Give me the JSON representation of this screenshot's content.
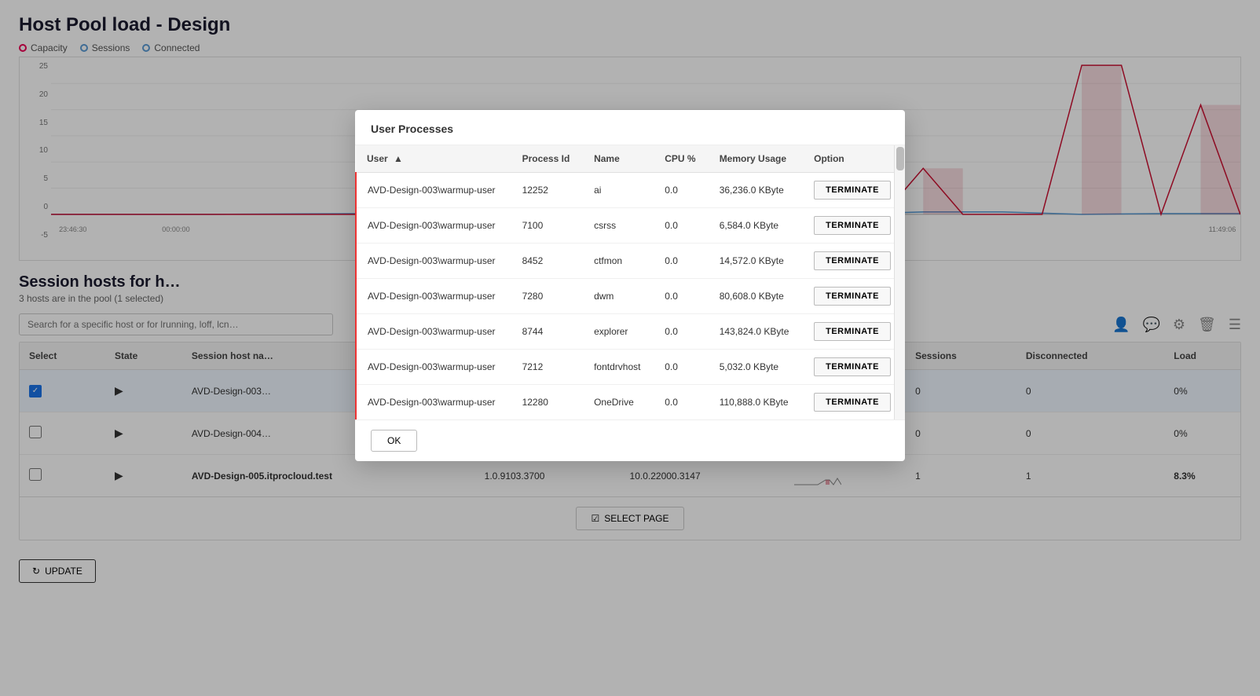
{
  "page": {
    "title": "Host Pool load - Design"
  },
  "legend": {
    "capacity_label": "Capacity",
    "sessions_label": "Sessions",
    "connected_label": "Connected"
  },
  "chart": {
    "y_axis": [
      "25",
      "20",
      "15",
      "10",
      "5",
      "0",
      "-5"
    ],
    "x_labels": [
      "23:46:30",
      "00:00:00",
      "11:49:06"
    ]
  },
  "session_hosts": {
    "title": "Session hosts for h…",
    "subtitle": "3 hosts are in the pool (1 selected)",
    "search_placeholder": "Search for a specific host or for lrunning, loff, lcn…",
    "columns": [
      "Select",
      "State",
      "Session host na…",
      "",
      "",
      "",
      "Sessions",
      "Disconnected",
      "Load"
    ],
    "rows": [
      {
        "select": true,
        "state": "running",
        "name": "AVD-Design-003…",
        "col4": "",
        "col5": "",
        "col6": "",
        "sessions": "0",
        "disconnected": "0",
        "load": "0%",
        "bold": false,
        "selected": true
      },
      {
        "select": false,
        "state": "running",
        "name": "AVD-Design-004…",
        "col4": "",
        "col5": "",
        "col6": "",
        "sessions": "0",
        "disconnected": "0",
        "load": "0%",
        "bold": false,
        "selected": false
      },
      {
        "select": false,
        "state": "running",
        "name": "AVD-Design-005.itprocloud.test",
        "col4": "1.0.9103.3700",
        "col5": "10.0.22000.3147",
        "col6": "",
        "sessions": "1",
        "disconnected": "1",
        "load": "8.3%",
        "bold": true,
        "selected": false
      }
    ],
    "select_page_label": "SELECT PAGE",
    "update_label": "UPDATE"
  },
  "modal": {
    "title": "User Processes",
    "columns": [
      {
        "label": "User ▲",
        "key": "user"
      },
      {
        "label": "Process Id",
        "key": "pid"
      },
      {
        "label": "Name",
        "key": "name"
      },
      {
        "label": "CPU %",
        "key": "cpu"
      },
      {
        "label": "Memory Usage",
        "key": "memory"
      },
      {
        "label": "Option",
        "key": "option"
      }
    ],
    "rows": [
      {
        "user": "AVD-Design-003\\warmup-user",
        "pid": "12252",
        "name": "ai",
        "cpu": "0.0",
        "memory": "36,236.0 KByte",
        "terminate": "TERMINATE"
      },
      {
        "user": "AVD-Design-003\\warmup-user",
        "pid": "7100",
        "name": "csrss",
        "cpu": "0.0",
        "memory": "6,584.0 KByte",
        "terminate": "TERMINATE"
      },
      {
        "user": "AVD-Design-003\\warmup-user",
        "pid": "8452",
        "name": "ctfmon",
        "cpu": "0.0",
        "memory": "14,572.0 KByte",
        "terminate": "TERMINATE"
      },
      {
        "user": "AVD-Design-003\\warmup-user",
        "pid": "7280",
        "name": "dwm",
        "cpu": "0.0",
        "memory": "80,608.0 KByte",
        "terminate": "TERMINATE"
      },
      {
        "user": "AVD-Design-003\\warmup-user",
        "pid": "8744",
        "name": "explorer",
        "cpu": "0.0",
        "memory": "143,824.0 KByte",
        "terminate": "TERMINATE"
      },
      {
        "user": "AVD-Design-003\\warmup-user",
        "pid": "7212",
        "name": "fontdrvhost",
        "cpu": "0.0",
        "memory": "5,032.0 KByte",
        "terminate": "TERMINATE"
      },
      {
        "user": "AVD-Design-003\\warmup-user",
        "pid": "12280",
        "name": "OneDrive",
        "cpu": "0.0",
        "memory": "110,888.0 KByte",
        "terminate": "TERMINATE"
      }
    ],
    "ok_label": "OK"
  }
}
